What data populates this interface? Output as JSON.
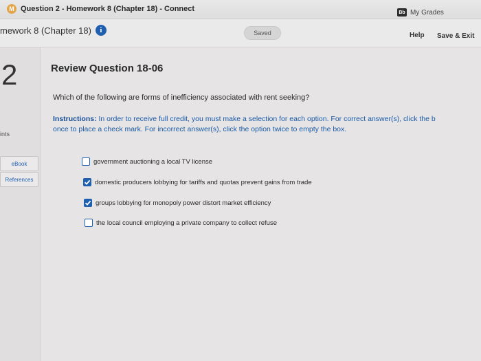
{
  "browser": {
    "tab_title": "Question 2 - Homework 8 (Chapter 18) - Connect",
    "favicon_letter": "M",
    "bookmark_label": "My Grades",
    "bookmark_icon_text": "Bb"
  },
  "header": {
    "assignment_title": "mework 8 (Chapter 18)",
    "saved_status": "Saved",
    "help_label": "Help",
    "save_exit_label": "Save & Exit"
  },
  "sidebar": {
    "question_number": "2",
    "points_label": "ints",
    "ebook_label": "eBook",
    "references_label": "References"
  },
  "question": {
    "title": "Review Question 18-06",
    "prompt": "Which of the following are forms of inefficiency associated with rent seeking?",
    "instructions_label": "Instructions:",
    "instructions_line1": " In order to receive full credit, you must make a selection for each option. For correct answer(s), click the b",
    "instructions_line2": "once to place a check mark. For incorrect answer(s), click the option twice to empty the box.",
    "options": [
      {
        "label": "government auctioning a local TV license",
        "checked": false
      },
      {
        "label": "domestic producers lobbying for tariffs and quotas prevent gains from trade",
        "checked": true
      },
      {
        "label": "groups lobbying for monopoly power distort market efficiency",
        "checked": true
      },
      {
        "label": "the local council employing a private company to collect refuse",
        "checked": false
      }
    ]
  },
  "colors": {
    "accent_blue": "#1f5fb0",
    "background": "#e6e4e4"
  }
}
